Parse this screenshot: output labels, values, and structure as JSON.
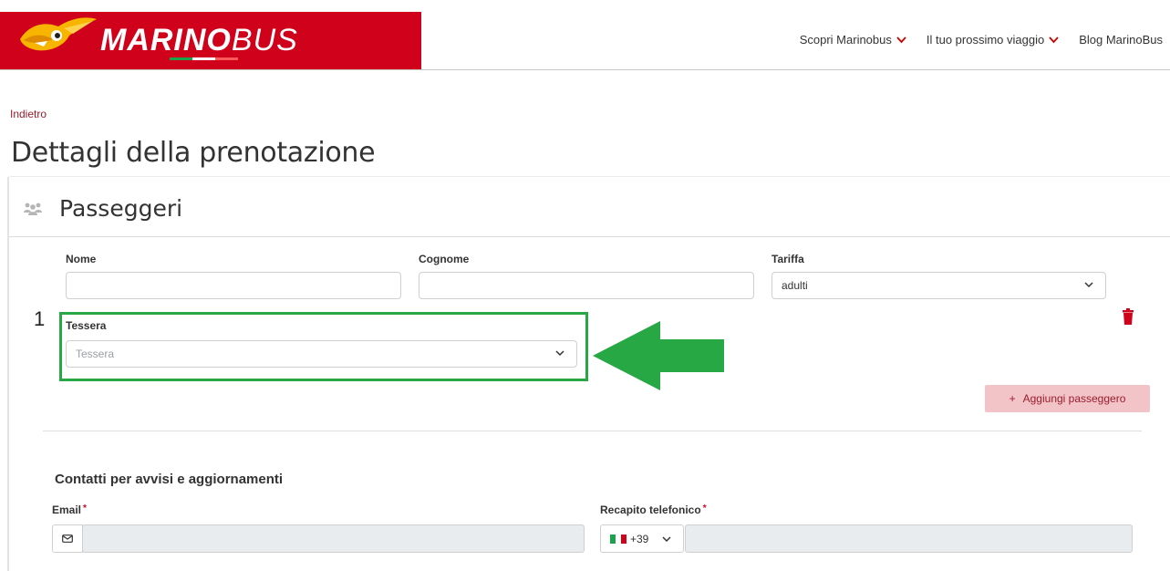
{
  "header": {
    "logo_bold": "MARINO",
    "logo_light": "BUS",
    "nav": [
      {
        "label": "Scopri Marinobus",
        "has_dropdown": true
      },
      {
        "label": "Il tuo prossimo viaggio",
        "has_dropdown": true
      },
      {
        "label": "Blog MarinoBus",
        "has_dropdown": false
      }
    ],
    "brand_color": "#d0021b"
  },
  "page": {
    "back_link": "Indietro",
    "title": "Dettagli della prenotazione"
  },
  "passengers": {
    "section_title": "Passeggeri",
    "section_icon": "users-icon",
    "items": [
      {
        "number": "1",
        "nome_label": "Nome",
        "nome_value": "",
        "cognome_label": "Cognome",
        "cognome_value": "",
        "tariffa_label": "Tariffa",
        "tariffa_value": "adulti",
        "tessera_label": "Tessera",
        "tessera_placeholder": "Tessera"
      }
    ],
    "add_button": {
      "icon": "+",
      "label": "Aggiungi passeggero"
    },
    "highlight_color": "#28a745"
  },
  "contacts": {
    "title": "Contatti per avvisi e aggiornamenti",
    "email_label": "Email",
    "email_required": "*",
    "phone_label": "Recapito telefonico",
    "phone_required": "*",
    "phone_prefix": "+39"
  }
}
